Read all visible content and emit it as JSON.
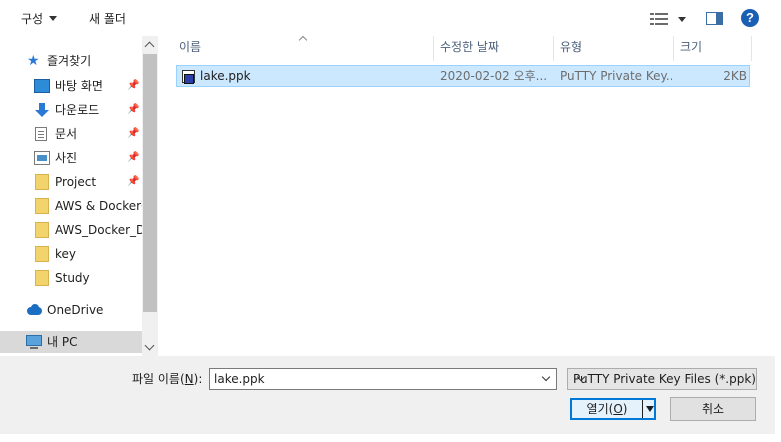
{
  "toolbar": {
    "organize_label": "구성",
    "new_folder_label": "새 폴더"
  },
  "nav": {
    "quick_access": "즐겨찾기",
    "items": [
      {
        "label": "바탕 화면",
        "icon": "desktop-icon",
        "pinned": true
      },
      {
        "label": "다운로드",
        "icon": "download-icon",
        "pinned": true
      },
      {
        "label": "문서",
        "icon": "document-icon",
        "pinned": true
      },
      {
        "label": "사진",
        "icon": "pictures-icon",
        "pinned": true
      },
      {
        "label": "Project",
        "icon": "folder-icon",
        "pinned": true
      },
      {
        "label": "AWS & Docker활",
        "icon": "folder-icon",
        "pinned": false
      },
      {
        "label": "AWS_Docker_De",
        "icon": "folder-icon",
        "pinned": false
      },
      {
        "label": "key",
        "icon": "folder-icon",
        "pinned": false
      },
      {
        "label": "Study",
        "icon": "folder-icon",
        "pinned": false
      }
    ],
    "onedrive": "OneDrive",
    "this_pc": "내 PC"
  },
  "columns": {
    "name": "이름",
    "date": "수정한 날짜",
    "type": "유형",
    "size": "크기"
  },
  "files": [
    {
      "name": "lake.ppk",
      "date": "2020-02-02 오후...",
      "type": "PuTTY Private Key...",
      "size": "2KB"
    }
  ],
  "bottom": {
    "filename_label_prefix": "파일 이름(",
    "filename_label_key": "N",
    "filename_label_suffix": "):",
    "filename_value": "lake.ppk",
    "filetype_value": "PuTTY Private Key Files (*.ppk)",
    "open_label_prefix": "열기(",
    "open_label_key": "O",
    "open_label_suffix": ")",
    "cancel_label": "취소"
  }
}
